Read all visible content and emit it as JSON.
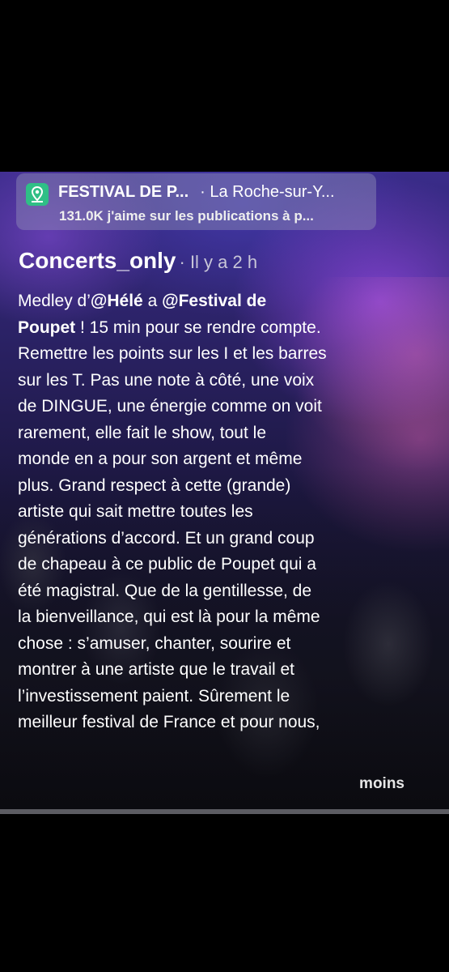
{
  "location": {
    "name": "FESTIVAL DE P...",
    "city": "· La Roche-sur-Y...",
    "likes": "131.0K j'aime sur les publications à p..."
  },
  "post": {
    "author": "Concerts_only",
    "time": "· Il y a 2 h",
    "lines": [
      [
        "Medley d’",
        "@Hélé",
        " a ",
        "@Festival de"
      ],
      [
        "Poupet",
        " ! 15 min pour se rendre compte."
      ],
      [
        "Remettre les points sur les I et les barres"
      ],
      [
        "sur les T. Pas une note à côté, une voix"
      ],
      [
        "de DINGUE, une énergie comme on voit"
      ],
      [
        "rarement, elle fait le show, tout le"
      ],
      [
        "monde en a pour son argent et même"
      ],
      [
        "plus. Grand respect à cette (grande)"
      ],
      [
        "artiste qui sait mettre toutes les"
      ],
      [
        "générations d’accord. Et un grand coup"
      ],
      [
        "de chapeau à ce public de Poupet qui a"
      ],
      [
        "été magistral. Que de la gentillesse, de"
      ],
      [
        "la bienveillance, qui est là pour la même"
      ],
      [
        "chose : s’amuser, chanter, sourire et"
      ],
      [
        "montrer à une artiste que le travail et"
      ],
      [
        "l’investissement paient. Sûrement le"
      ],
      [
        "meilleur festival de France et pour nous,"
      ]
    ],
    "more_label": "moins"
  },
  "colors": {
    "location_icon": "#2fbf86",
    "background_purple": "#3a2c8a"
  },
  "icons": {
    "location": "map-pin-icon"
  }
}
